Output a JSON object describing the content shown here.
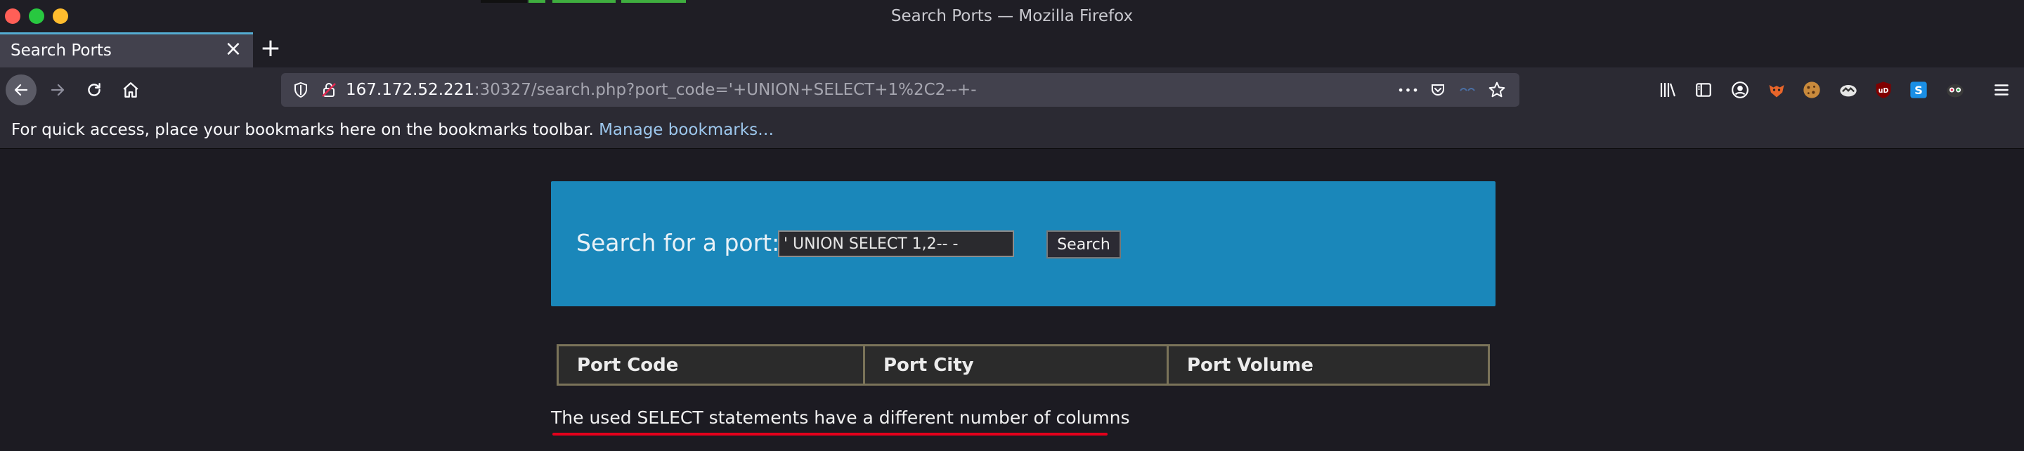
{
  "window": {
    "title": "Search Ports — Mozilla Firefox"
  },
  "tabs": [
    {
      "label": "Search Ports",
      "close": "×"
    }
  ],
  "tabbar": {
    "new_tab": "+"
  },
  "urlbar": {
    "host": "167.172.52.221",
    "rest": ":30327/search.php?port_code='+UNION+SELECT+1%2C2--+-",
    "more": "•••"
  },
  "bookmarks": {
    "message": "For quick access, place your bookmarks here on the bookmarks toolbar.",
    "manage_link": "Manage bookmarks…"
  },
  "page": {
    "search_label": "Search for a port:",
    "search_value": "' UNION SELECT 1,2-- -",
    "search_button": "Search",
    "table_headers": [
      "Port Code",
      "Port City",
      "Port Volume"
    ],
    "error_message": "The used SELECT statements have a different number of columns"
  },
  "colors": {
    "panel": "#1a87ba",
    "underline": "#e3001b",
    "link": "#9dc7ed"
  }
}
